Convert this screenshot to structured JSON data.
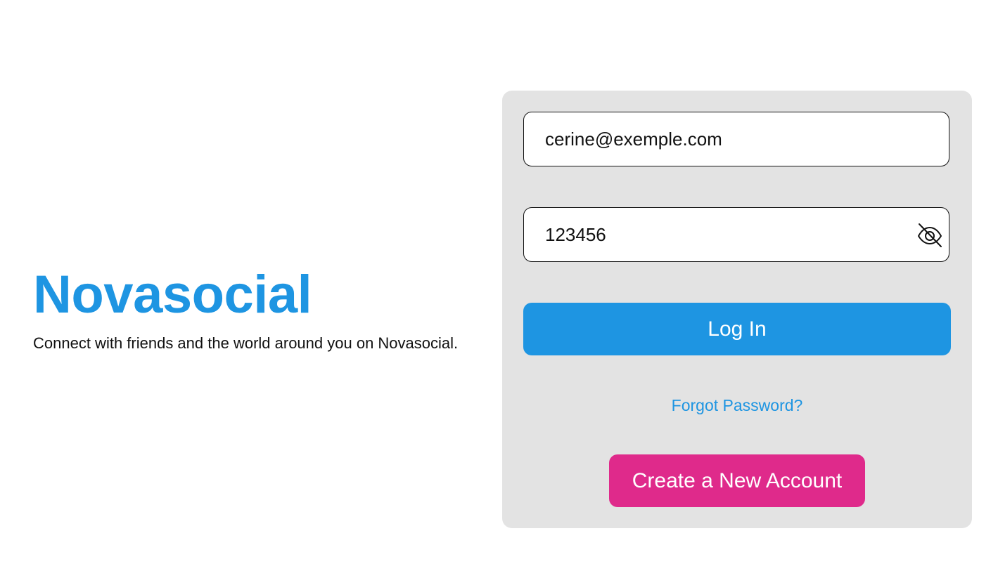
{
  "brand": {
    "name": "Novasocial",
    "tagline": "Connect with friends and the world around you on Novasocial."
  },
  "login_form": {
    "email": {
      "value": "cerine@exemple.com",
      "type": "email"
    },
    "password": {
      "value": "123456",
      "type": "text",
      "toggle_icon": "eye-off-icon"
    },
    "login_label": "Log In",
    "forgot_label": "Forgot Password?",
    "create_label": "Create a New Account"
  },
  "colors": {
    "brand": "#1e95e2",
    "create_account": "#df2a8b",
    "card_background": "#e3e3e3",
    "page_background": "#ffffff"
  }
}
